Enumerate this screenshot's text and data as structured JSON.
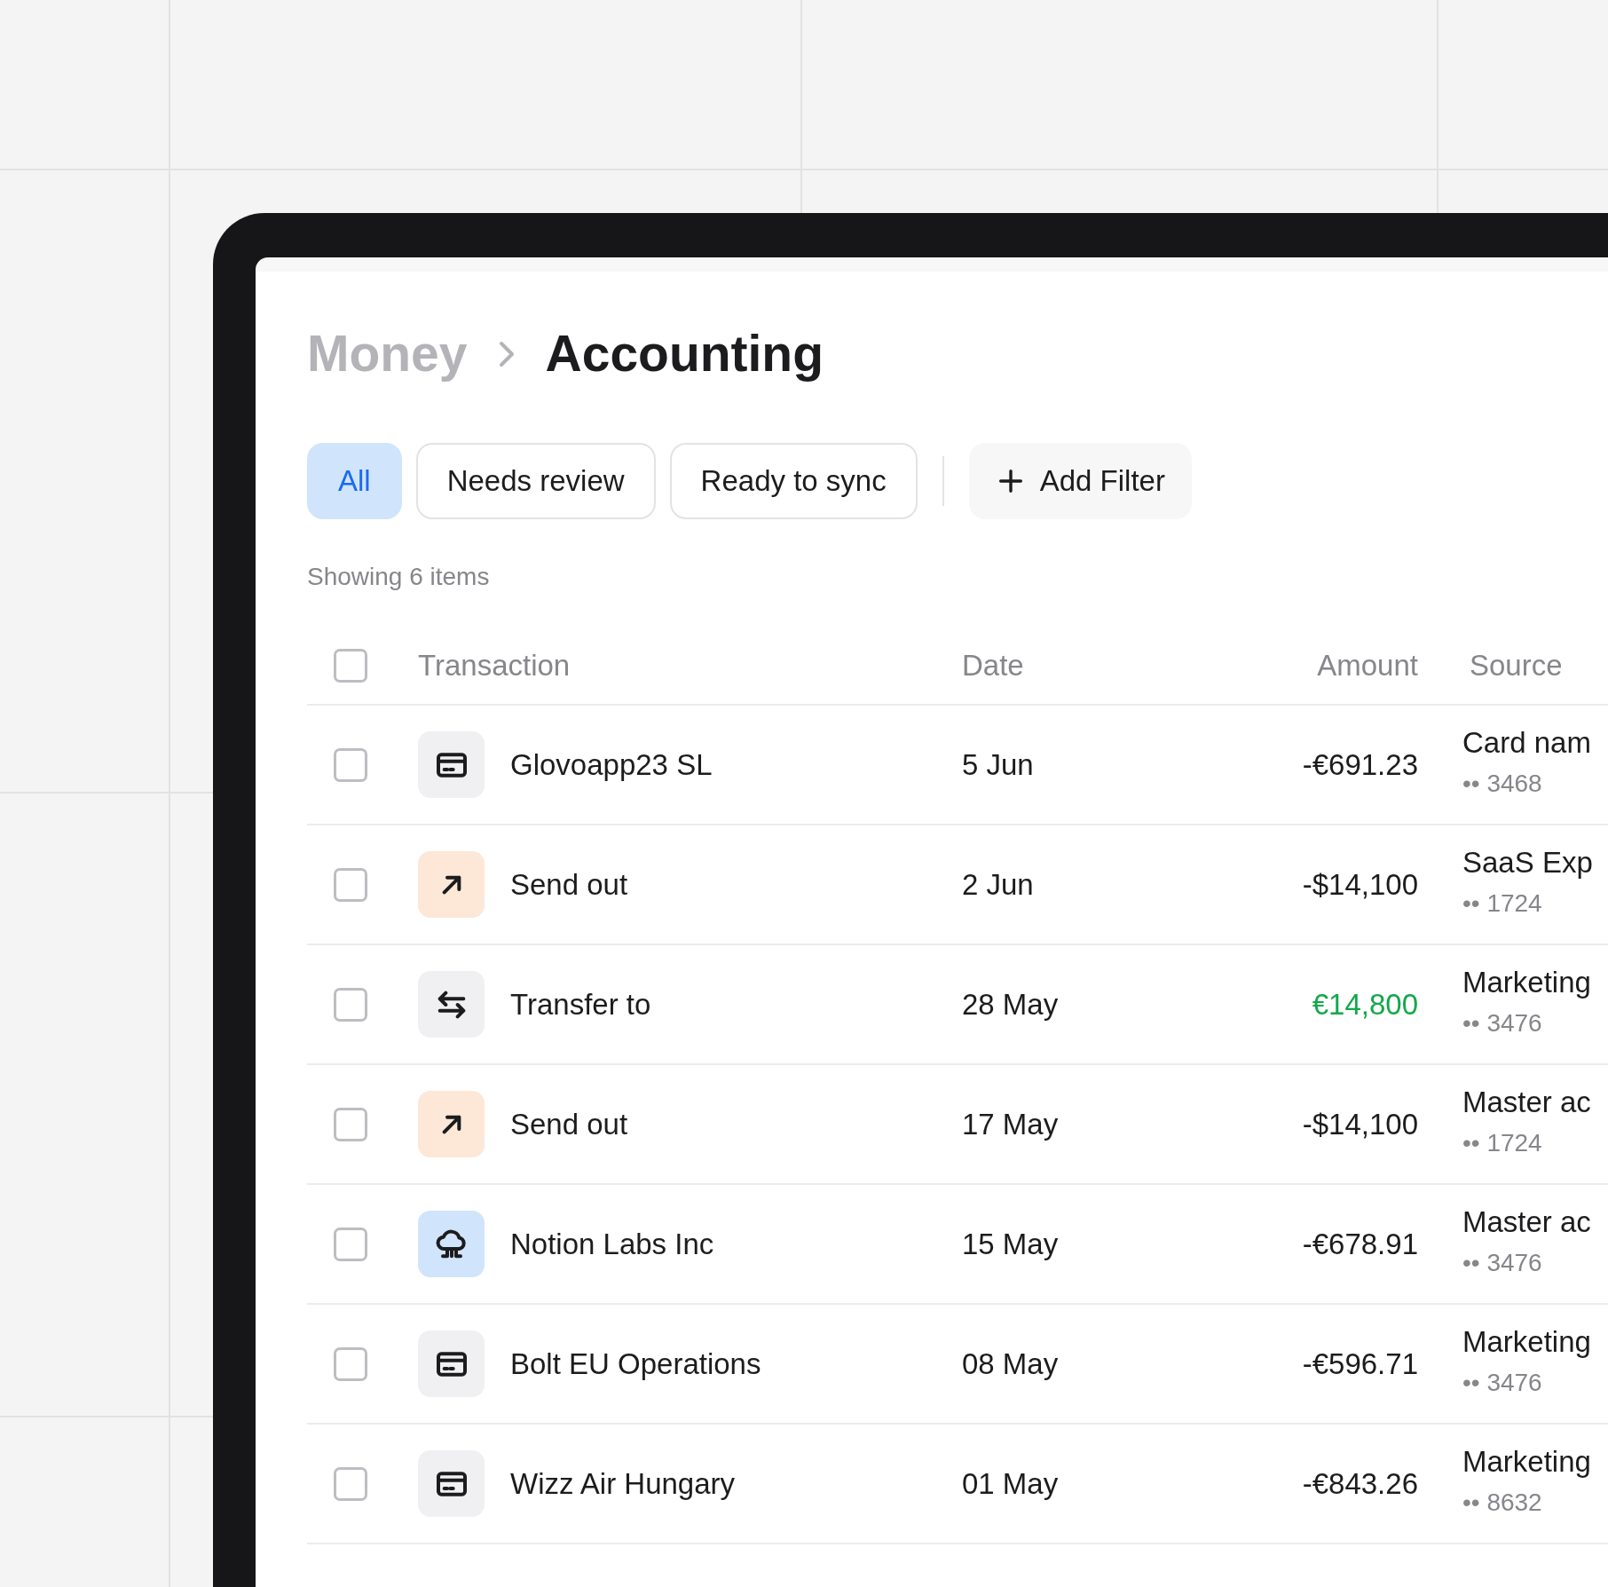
{
  "breadcrumb": {
    "parent": "Money",
    "current": "Accounting"
  },
  "filters": [
    {
      "label": "All",
      "selected": true
    },
    {
      "label": "Needs review",
      "selected": false
    },
    {
      "label": "Ready to sync",
      "selected": false
    }
  ],
  "add_filter": {
    "label": "Add Filter"
  },
  "count_text": "Showing 6 items",
  "table": {
    "select_all": {
      "checked": false
    },
    "columns": [
      "Transaction",
      "Date",
      "Amount",
      "Source"
    ],
    "rows": [
      {
        "checked": false,
        "kind": "card",
        "name": "Glovoapp23 SL",
        "date": "5 Jun",
        "amount": "-€691.23",
        "positive": false,
        "source": "Card nam",
        "account": "•• 3468"
      },
      {
        "checked": false,
        "kind": "send",
        "name": "Send out",
        "date": "2 Jun",
        "amount": "-$14,100",
        "positive": false,
        "source": "SaaS Exp",
        "account": "•• 1724"
      },
      {
        "checked": false,
        "kind": "transfer",
        "name": "Transfer to",
        "date": "28 May",
        "amount": "€14,800",
        "positive": true,
        "source": "Marketing",
        "account": "•• 3476"
      },
      {
        "checked": false,
        "kind": "send",
        "name": "Send out",
        "date": "17 May",
        "amount": "-$14,100",
        "positive": false,
        "source": "Master ac",
        "account": "•• 1724"
      },
      {
        "checked": false,
        "kind": "cloud",
        "name": "Notion Labs Inc",
        "date": "15 May",
        "amount": "-€678.91",
        "positive": false,
        "source": "Master ac",
        "account": "•• 3476"
      },
      {
        "checked": false,
        "kind": "card",
        "name": "Bolt EU Operations",
        "date": "08 May",
        "amount": "-€596.71",
        "positive": false,
        "source": "Marketing",
        "account": "•• 3476"
      },
      {
        "checked": false,
        "kind": "card",
        "name": "Wizz Air Hungary",
        "date": "01 May",
        "amount": "-€843.26",
        "positive": false,
        "source": "Marketing",
        "account": "•• 8632"
      }
    ]
  }
}
